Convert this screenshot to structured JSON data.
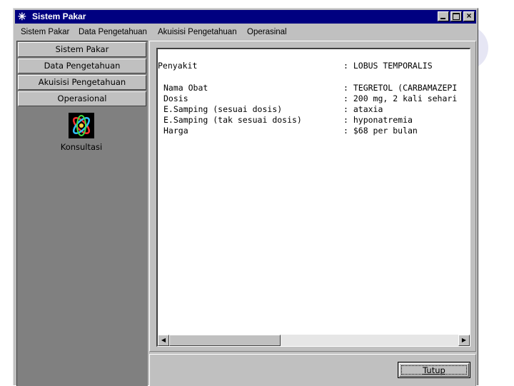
{
  "window": {
    "title": "Sistem Pakar",
    "icon": "asterisk-star-icon"
  },
  "menubar": {
    "items": [
      "Sistem Pakar",
      "Data Pengetahuan",
      "Akuisisi Pengetahuan",
      "Operasinal"
    ]
  },
  "sidebar": {
    "buttons": [
      "Sistem Pakar",
      "Data Pengetahuan",
      "Akuisisi Pengetahuan",
      "Operasional"
    ],
    "konsultasi_label": "Konsultasi",
    "konsultasi_icon": "atom-orbit-icon"
  },
  "content": {
    "penyakit_label": "Penyakit",
    "penyakit_value": ": LOBUS TEMPORALIS",
    "rows": [
      {
        "label": "Nama Obat",
        "value": ": TEGRETOL (CARBAMAZEPI"
      },
      {
        "label": "Dosis",
        "value": ": 200 mg, 2 kali sehari"
      },
      {
        "label": "E.Samping (sesuai dosis)",
        "value": ": ataxia"
      },
      {
        "label": "E.Samping (tak sesuai dosis)",
        "value": ": hyponatremia"
      },
      {
        "label": "Harga",
        "value": ": $68 per bulan"
      }
    ]
  },
  "footer": {
    "tutup_label": "Tutup"
  },
  "colors": {
    "titlebar": "#000080",
    "face": "#c0c0c0",
    "sidebar_bg": "#808080"
  }
}
